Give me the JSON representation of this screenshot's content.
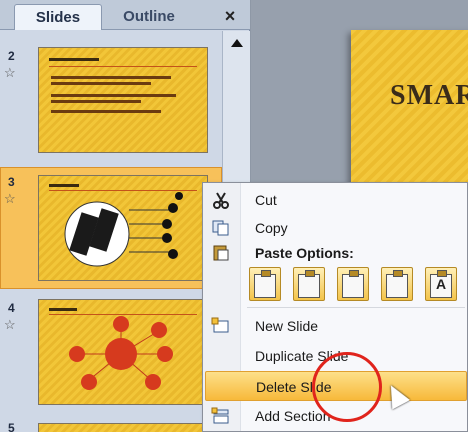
{
  "pane": {
    "tabs": {
      "slides": "Slides",
      "outline": "Outline",
      "close": "×"
    },
    "slides": [
      {
        "number": "2",
        "selected": false
      },
      {
        "number": "3",
        "selected": true
      },
      {
        "number": "4",
        "selected": false
      },
      {
        "number": "5",
        "selected": false
      }
    ]
  },
  "main": {
    "title": "SMAR"
  },
  "menu": {
    "cut": "Cut",
    "copy": "Copy",
    "paste_options": "Paste Options:",
    "paste_glyph_text": "A",
    "new_slide": "New Slide",
    "duplicate_slide": "Duplicate Slide",
    "delete_slide": "Delete Slide",
    "add_section": "Add Section"
  },
  "colors": {
    "highlight": "#f7b93a",
    "annotation": "#e0241c",
    "slide_bg": "#f2c638"
  }
}
